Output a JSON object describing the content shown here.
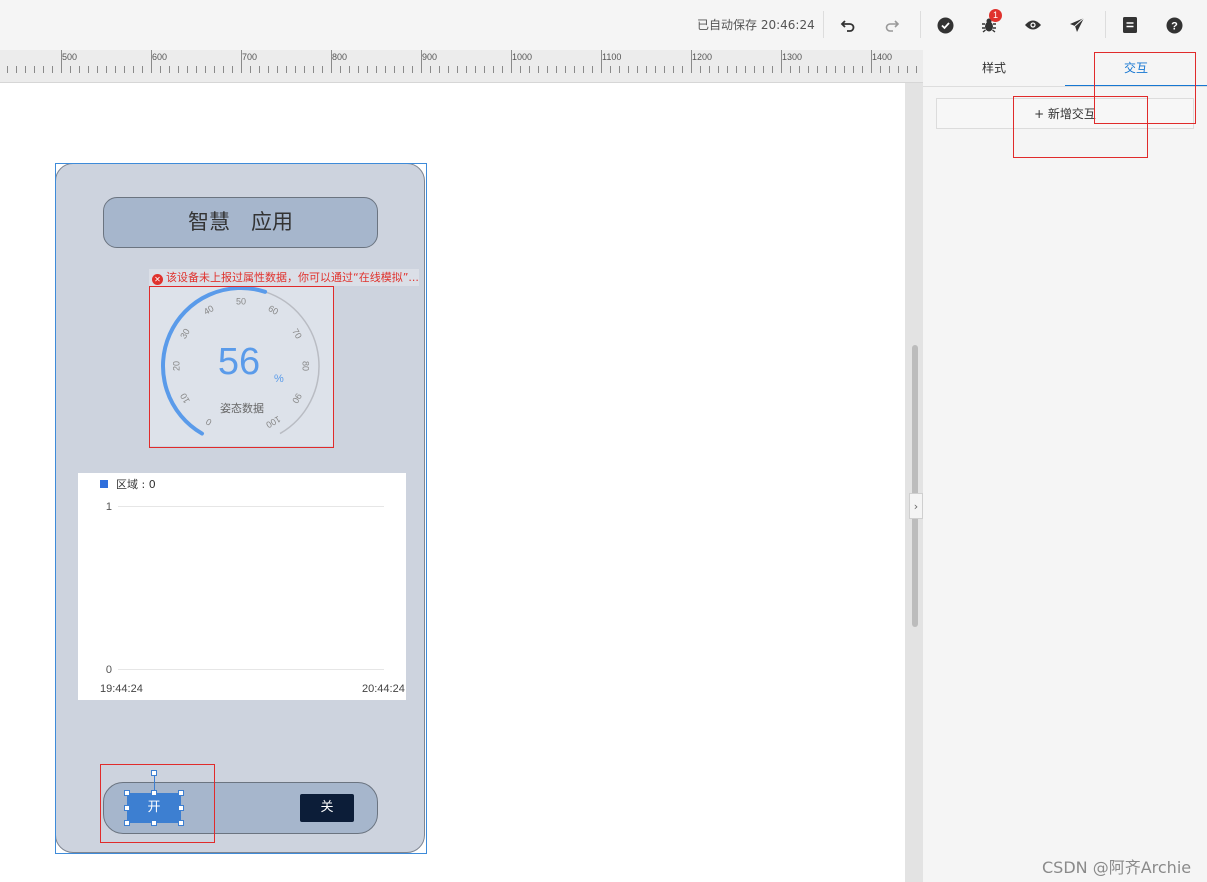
{
  "toolbar": {
    "autosave_text": "已自动保存 20:46:24",
    "debug_badge": "1",
    "icons": [
      "undo-icon",
      "redo-icon",
      "check-icon",
      "bug-icon",
      "eye-icon",
      "send-icon",
      "document-icon",
      "help-icon"
    ]
  },
  "ruler": {
    "labels": [
      "500",
      "600",
      "700",
      "800",
      "900",
      "1000",
      "1100",
      "1200",
      "1300",
      "1400"
    ]
  },
  "right_panel": {
    "tabs": [
      {
        "label": "样式",
        "active": false
      },
      {
        "label": "交互",
        "active": true
      }
    ],
    "add_interaction_label": "+ 新增交互"
  },
  "phone": {
    "title": "智慧　应用",
    "error_text": "该设备未上报过属性数据，你可以通过“在线模拟”...",
    "gauge": {
      "value": "56",
      "unit": "%",
      "label": "姿态数据",
      "ticks": [
        "0",
        "10",
        "20",
        "30",
        "40",
        "50",
        "60",
        "70",
        "80",
        "90",
        "100"
      ],
      "min": 0,
      "max": 100,
      "accent_color": "#5a9bea"
    },
    "switch": {
      "on_label": "开",
      "off_label": "关"
    }
  },
  "chart_data": {
    "type": "line",
    "legend": [
      {
        "name": "区域 : 0",
        "color": "#2f6fdc"
      }
    ],
    "x": [
      "19:44:24",
      "20:44:24"
    ],
    "series": [
      {
        "name": "区域 : 0",
        "values": []
      }
    ],
    "ylim": [
      0,
      1
    ],
    "y_ticks": [
      "1",
      "0"
    ],
    "grid": true,
    "legend_position": "top-left"
  },
  "watermark": "CSDN @阿齐Archie",
  "colors": {
    "accent": "#1677d2",
    "error": "#e0322d",
    "phone_bg": "#cdd3de",
    "pill_bg": "#a6b6cc",
    "on_button": "#3d7fd1",
    "off_button": "#0c1d38"
  }
}
